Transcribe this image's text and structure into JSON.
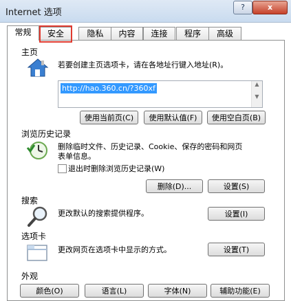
{
  "window": {
    "title": "Internet 选项",
    "help_label": "?",
    "close_label": "x"
  },
  "tabs": [
    {
      "label": "常规"
    },
    {
      "label": "安全"
    },
    {
      "label": "隐私"
    },
    {
      "label": "内容"
    },
    {
      "label": "连接"
    },
    {
      "label": "程序"
    },
    {
      "label": "高级"
    }
  ],
  "homepage": {
    "label": "主页",
    "description": "若要创建主页选项卡，请在各地址行键入地址(R)。",
    "url": "http://hao.360.cn/?360xf",
    "buttons": {
      "use_current": "使用当前页(C)",
      "use_default": "使用默认值(F)",
      "use_blank": "使用空白页(B)"
    }
  },
  "history": {
    "label": "浏览历史记录",
    "description_line1": "删除临时文件、历史记录、Cookie、保存的密码和网页",
    "description_line2": "表单信息。",
    "checkbox_label": "退出时删除浏览历史记录(W)",
    "delete_button": "删除(D)...",
    "settings_button": "设置(S)"
  },
  "search": {
    "label": "搜索",
    "description": "更改默认的搜索提供程序。",
    "settings_button": "设置(I)"
  },
  "tabs_section": {
    "label": "选项卡",
    "description": "更改网页在选项卡中显示的方式。",
    "settings_button": "设置(T)"
  },
  "appearance": {
    "label": "外观",
    "buttons": {
      "colors": "颜色(O)",
      "languages": "语言(L)",
      "fonts": "字体(N)",
      "accessibility": "辅助功能(E)"
    }
  }
}
